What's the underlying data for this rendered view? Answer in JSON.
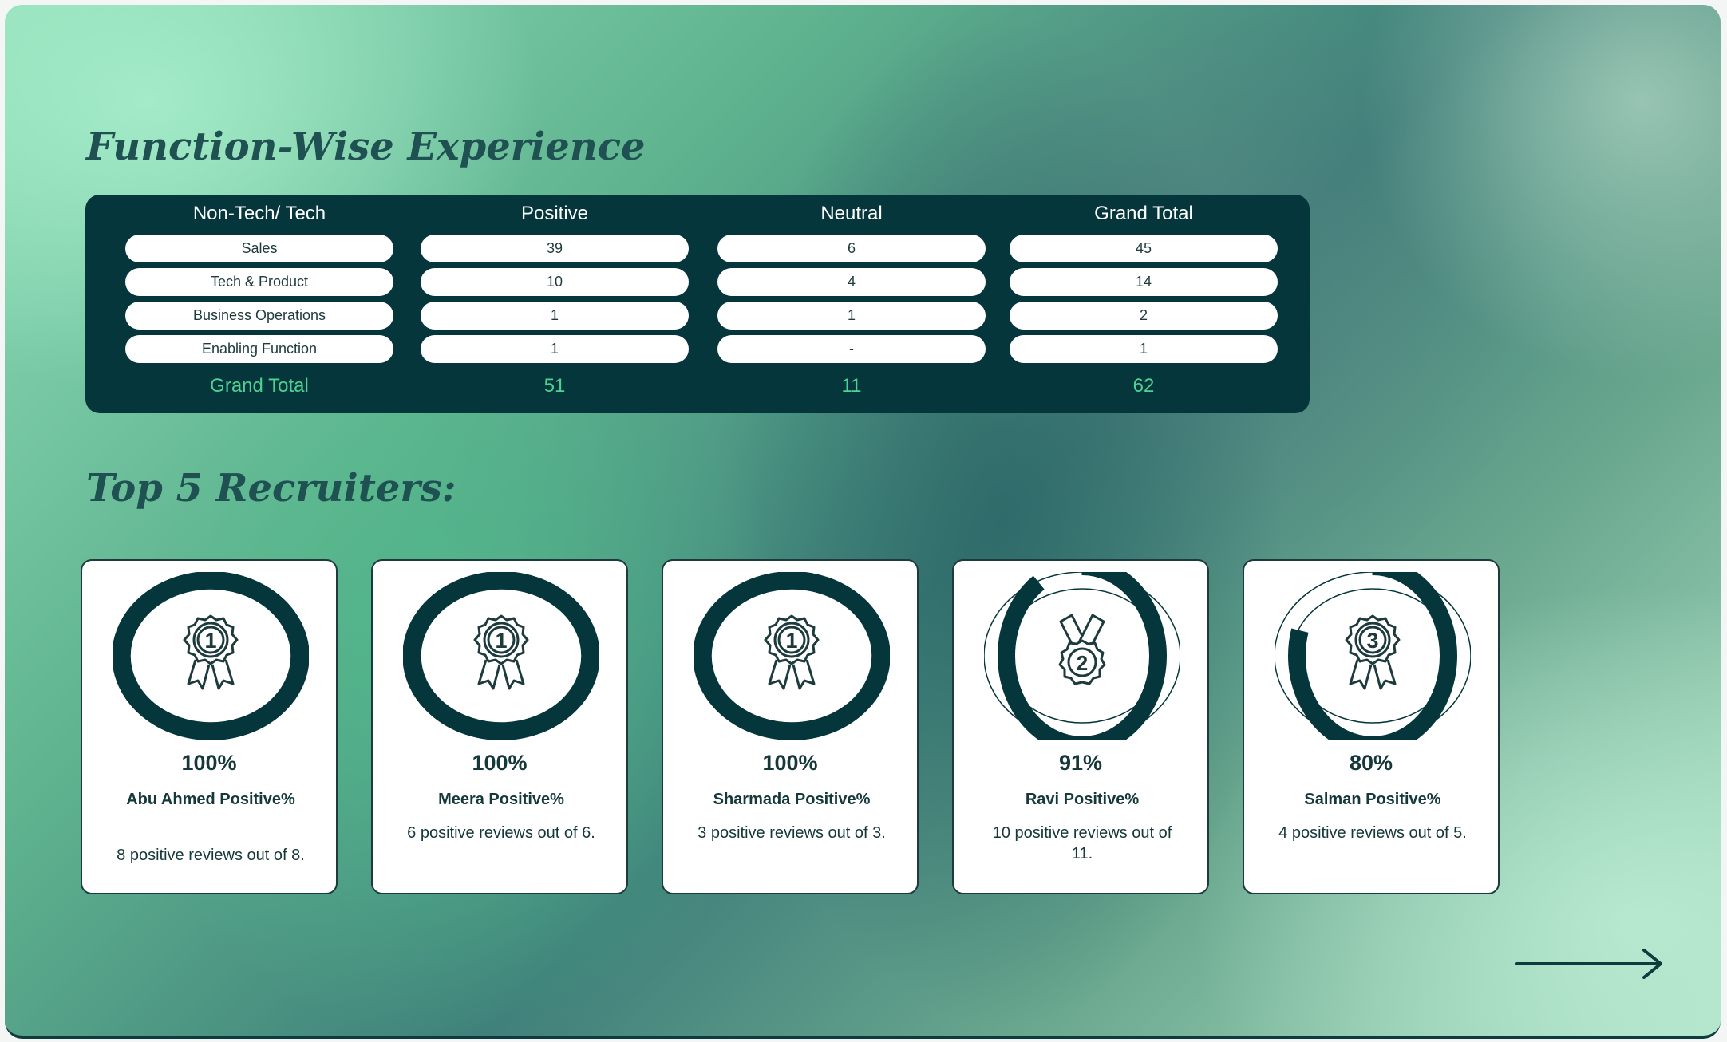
{
  "sections": {
    "function_title": "Function-Wise Experience",
    "recruiters_title": "Top 5 Recruiters:"
  },
  "table": {
    "headers": [
      "Non-Tech/ Tech",
      "Positive",
      "Neutral",
      "Grand Total"
    ],
    "rows": [
      [
        "Sales",
        "39",
        "6",
        "45"
      ],
      [
        "Tech & Product",
        "10",
        "4",
        "14"
      ],
      [
        "Business Operations",
        "1",
        "1",
        "2"
      ],
      [
        "Enabling Function",
        "1",
        "-",
        "1"
      ]
    ],
    "totals": [
      "Grand Total",
      "51",
      "11",
      "62"
    ]
  },
  "recruiters": [
    {
      "percent": "100%",
      "fraction": 1.0,
      "name": "Abu Ahmed Positive%",
      "reviews": "8 positive reviews out of 8.",
      "rank": "1",
      "icon": "rosette-1-icon"
    },
    {
      "percent": "100%",
      "fraction": 1.0,
      "name": "Meera Positive%",
      "reviews": "6 positive reviews out of 6.",
      "rank": "1",
      "icon": "rosette-1-icon"
    },
    {
      "percent": "100%",
      "fraction": 1.0,
      "name": "Sharmada Positive%",
      "reviews": "3 positive reviews out of 3.",
      "rank": "1",
      "icon": "rosette-1-icon"
    },
    {
      "percent": "91%",
      "fraction": 0.91,
      "name": "Ravi Positive%",
      "reviews": "10 positive reviews out of 11.",
      "rank": "2",
      "icon": "medal-2-icon"
    },
    {
      "percent": "80%",
      "fraction": 0.8,
      "name": "Salman Positive%",
      "reviews": "4 positive reviews out of 5.",
      "rank": "3",
      "icon": "rosette-3-icon"
    }
  ],
  "colors": {
    "dark": "#04363b",
    "accent_green": "#4dd293",
    "ring_track": "#ffffff"
  },
  "nav": {
    "next_icon": "arrow-right-icon"
  }
}
